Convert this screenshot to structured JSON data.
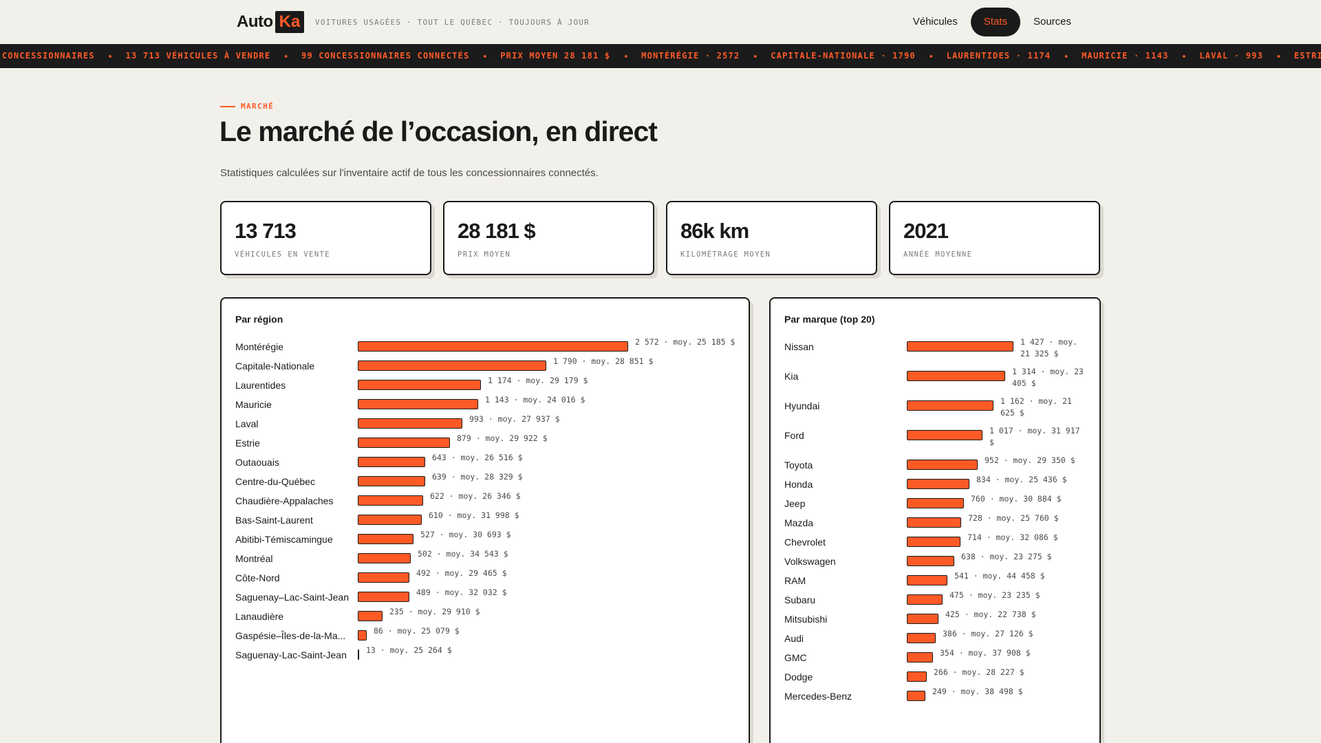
{
  "header": {
    "logo_text": "Auto",
    "logo_badge": "Ka",
    "tagline": "VOITURES USAGÉES · TOUT LE QUÉBEC · TOUJOURS À JOUR",
    "nav": [
      {
        "label": "Véhicules",
        "active": false
      },
      {
        "label": "Stats",
        "active": true
      },
      {
        "label": "Sources",
        "active": false
      }
    ]
  },
  "ticker": [
    "CONCESSIONNAIRES",
    "13 713 VÉHICULES À VENDRE",
    "99 CONCESSIONNAIRES CONNECTÉS",
    "PRIX MOYEN 28 181 $",
    "MONTÉRÉGIE · 2572",
    "CAPITALE-NATIONALE · 1790",
    "LAURENTIDES · 1174",
    "MAURICIE · 1143",
    "LAVAL · 993",
    "ESTRIE"
  ],
  "hero": {
    "eyebrow": "MARCHÉ",
    "title": "Le marché de l’occasion, en direct",
    "subtitle": "Statistiques calculées sur l'inventaire actif de tous les concessionnaires connectés."
  },
  "stats": [
    {
      "value": "13 713",
      "label": "VÉHICULES EN VENTE"
    },
    {
      "value": "28 181 $",
      "label": "PRIX MOYEN"
    },
    {
      "value": "86k km",
      "label": "KILOMÉTRAGE MOYEN"
    },
    {
      "value": "2021",
      "label": "ANNÉE MOYENNE"
    }
  ],
  "colors": {
    "accent": "#ff5a26",
    "ink": "#1a1a1a",
    "background": "#f2f0eb"
  },
  "region_panel": {
    "title": "Par région",
    "rows": [
      {
        "name": "Montérégie",
        "count": 2572,
        "label": "2 572 · moy. 25 185 $"
      },
      {
        "name": "Capitale-Nationale",
        "count": 1790,
        "label": "1 790 · moy. 28 851 $"
      },
      {
        "name": "Laurentides",
        "count": 1174,
        "label": "1 174 · moy. 29 179 $"
      },
      {
        "name": "Mauricie",
        "count": 1143,
        "label": "1 143 · moy. 24 016 $"
      },
      {
        "name": "Laval",
        "count": 993,
        "label": "993 · moy. 27 937 $"
      },
      {
        "name": "Estrie",
        "count": 879,
        "label": "879 · moy. 29 922 $"
      },
      {
        "name": "Outaouais",
        "count": 643,
        "label": "643 · moy. 26 516 $"
      },
      {
        "name": "Centre-du-Québec",
        "count": 639,
        "label": "639 · moy. 28 329 $"
      },
      {
        "name": "Chaudière-Appalaches",
        "count": 622,
        "label": "622 · moy. 26 346 $"
      },
      {
        "name": "Bas-Saint-Laurent",
        "count": 610,
        "label": "610 · moy. 31 998 $"
      },
      {
        "name": "Abitibi-Témiscamingue",
        "count": 527,
        "label": "527 · moy. 30 693 $"
      },
      {
        "name": "Montréal",
        "count": 502,
        "label": "502 · moy. 34 543 $"
      },
      {
        "name": "Côte-Nord",
        "count": 492,
        "label": "492 · moy. 29 465 $"
      },
      {
        "name": "Saguenay–Lac-Saint-Jean",
        "count": 489,
        "label": "489 · moy. 32 032 $"
      },
      {
        "name": "Lanaudière",
        "count": 235,
        "label": "235 · moy. 29 910 $"
      },
      {
        "name": "Gaspésie–Îles-de-la-Ma...",
        "count": 86,
        "label": "86 · moy. 25 079 $"
      },
      {
        "name": "Saguenay-Lac-Saint-Jean",
        "count": 13,
        "label": "13 · moy. 25 264 $"
      }
    ]
  },
  "brand_panel": {
    "title": "Par marque (top 20)",
    "rows": [
      {
        "name": "Nissan",
        "count": 1427,
        "label": "1 427 · moy. 21 325 $"
      },
      {
        "name": "Kia",
        "count": 1314,
        "label": "1 314 · moy. 23 405 $"
      },
      {
        "name": "Hyundai",
        "count": 1162,
        "label": "1 162 · moy. 21 625 $"
      },
      {
        "name": "Ford",
        "count": 1017,
        "label": "1 017 · moy. 31 917 $"
      },
      {
        "name": "Toyota",
        "count": 952,
        "label": "952 · moy. 29 350 $"
      },
      {
        "name": "Honda",
        "count": 834,
        "label": "834 · moy. 25 436 $"
      },
      {
        "name": "Jeep",
        "count": 760,
        "label": "760 · moy. 30 884 $"
      },
      {
        "name": "Mazda",
        "count": 728,
        "label": "728 · moy. 25 760 $"
      },
      {
        "name": "Chevrolet",
        "count": 714,
        "label": "714 · moy. 32 086 $"
      },
      {
        "name": "Volkswagen",
        "count": 638,
        "label": "638 · moy. 23 275 $"
      },
      {
        "name": "RAM",
        "count": 541,
        "label": "541 · moy. 44 458 $"
      },
      {
        "name": "Subaru",
        "count": 475,
        "label": "475 · moy. 23 235 $"
      },
      {
        "name": "Mitsubishi",
        "count": 425,
        "label": "425 · moy. 22 738 $"
      },
      {
        "name": "Audi",
        "count": 386,
        "label": "386 · moy. 27 126 $"
      },
      {
        "name": "GMC",
        "count": 354,
        "label": "354 · moy. 37 908 $"
      },
      {
        "name": "Dodge",
        "count": 266,
        "label": "266 · moy. 28 227 $"
      },
      {
        "name": "Mercedes-Benz",
        "count": 249,
        "label": "249 · moy. 38 498 $"
      }
    ]
  }
}
